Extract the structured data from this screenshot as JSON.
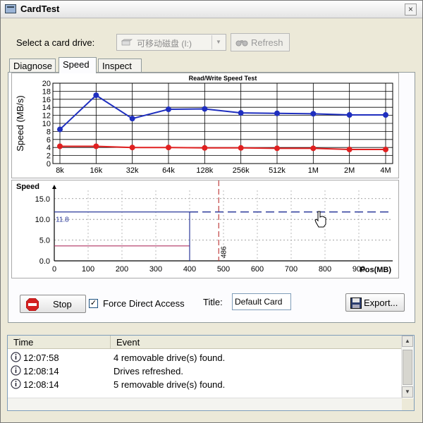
{
  "window": {
    "title": "CardTest",
    "close_glyph": "×"
  },
  "drive": {
    "label": "Select a card drive:",
    "selected": "可移动磁盘 (I:)",
    "refresh_label": "Refresh"
  },
  "tabs": [
    {
      "label": "Diagnose",
      "active": false
    },
    {
      "label": "Speed",
      "active": true
    },
    {
      "label": "Inspect",
      "active": false
    }
  ],
  "chart_data": [
    {
      "type": "line",
      "title": "Read/Write Speed Test",
      "ylabel": "Speed (MB/s)",
      "xlabel": "",
      "categories": [
        "8k",
        "16k",
        "32k",
        "64k",
        "128k",
        "256k",
        "512k",
        "1M",
        "2M",
        "4M"
      ],
      "ylim": [
        0,
        20
      ],
      "yticks": [
        "0",
        "2",
        "4",
        "6",
        "8",
        "10",
        "12",
        "14",
        "16",
        "18",
        "20"
      ],
      "grid": true,
      "series": [
        {
          "color": "#1f2fbf",
          "values": [
            8.5,
            17,
            11.2,
            13.5,
            13.6,
            12.6,
            12.5,
            12.4,
            12.1,
            12.1
          ]
        },
        {
          "color": "#e02020",
          "values": [
            4.3,
            4.3,
            4.0,
            4.0,
            3.9,
            3.9,
            3.8,
            3.8,
            3.5,
            3.5
          ]
        }
      ]
    },
    {
      "type": "line",
      "ylabel": "Speed",
      "xlabel": "Pos(MB)",
      "xlim": [
        0,
        1000
      ],
      "xticks": [
        "0",
        "100",
        "200",
        "300",
        "400",
        "500",
        "600",
        "700",
        "800",
        "900"
      ],
      "ylim": [
        0,
        17
      ],
      "yticks": [
        "0.0",
        "5.0",
        "10.0",
        "15.0"
      ],
      "grid": true,
      "annotations": [
        {
          "text": "11.8",
          "value": 11.8
        },
        {
          "text": "486",
          "x": 486
        }
      ],
      "series": [
        {
          "color": "#2b3a9a",
          "x": [
            0,
            400
          ],
          "values": [
            11.8,
            11.8
          ]
        },
        {
          "color": "#b03060",
          "x": [
            0,
            400
          ],
          "values": [
            3.6,
            3.6
          ]
        }
      ]
    }
  ],
  "controls": {
    "stop_label": "Stop",
    "force_direct_label": "Force Direct Access",
    "force_direct_checked": true,
    "check_glyph": "✓",
    "title_label": "Title:",
    "title_value": "Default Card",
    "export_label": "Export..."
  },
  "log": {
    "columns": [
      "Time",
      "Event"
    ],
    "rows": [
      {
        "time": "12:07:58",
        "event": "4 removable drive(s) found."
      },
      {
        "time": "12:08:14",
        "event": "Drives refreshed."
      },
      {
        "time": "12:08:14",
        "event": "5 removable drive(s) found."
      }
    ]
  },
  "scroll": {
    "up": "▲",
    "down": "▼"
  }
}
